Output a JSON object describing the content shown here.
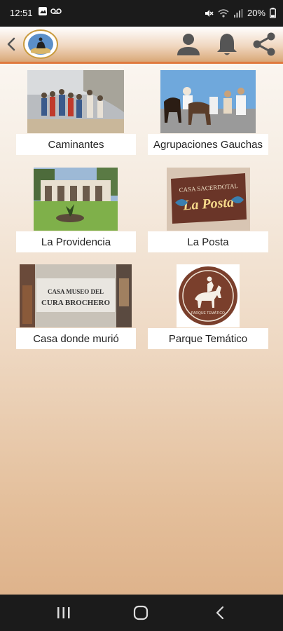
{
  "status_bar": {
    "time": "12:51",
    "battery": "20%",
    "icons": [
      "gallery-icon",
      "voicemail-icon",
      "mute-icon",
      "wifi-icon",
      "signal-icon",
      "battery-icon"
    ]
  },
  "app_bar": {
    "back_icon": "chevron-left-icon",
    "logo": "cura-brochero-logo",
    "actions": [
      "person-icon",
      "bell-icon",
      "share-icon"
    ]
  },
  "grid": {
    "items": [
      {
        "label": "Caminantes",
        "image": "pilgrims-walking-photo"
      },
      {
        "label": "Agrupaciones Gauchas",
        "image": "gauchos-on-horses-photo"
      },
      {
        "label": "La Providencia",
        "image": "la-providencia-building-photo"
      },
      {
        "label": "La Posta",
        "image": "la-posta-sign-photo"
      },
      {
        "label": "Casa donde murió",
        "image": "casa-museo-photo",
        "sign_text": "CASA MUSEO DEL CURA BROCHERO"
      },
      {
        "label": "Parque Temático",
        "image": "parque-tematico-logo",
        "sign_text": "PARQUE TEMÁTICO"
      }
    ]
  },
  "images": {
    "la_posta_sign_top": "CASA SACERDOTAL",
    "la_posta_sign_main": "La Posta"
  },
  "colors": {
    "accent": "#e07a3f",
    "brown": "#7a3f2c",
    "header_gradient_end": "#d9a878",
    "background_bottom": "#dcae85"
  },
  "nav_bar": {
    "buttons": [
      "recent-apps-icon",
      "home-icon",
      "back-icon"
    ]
  }
}
